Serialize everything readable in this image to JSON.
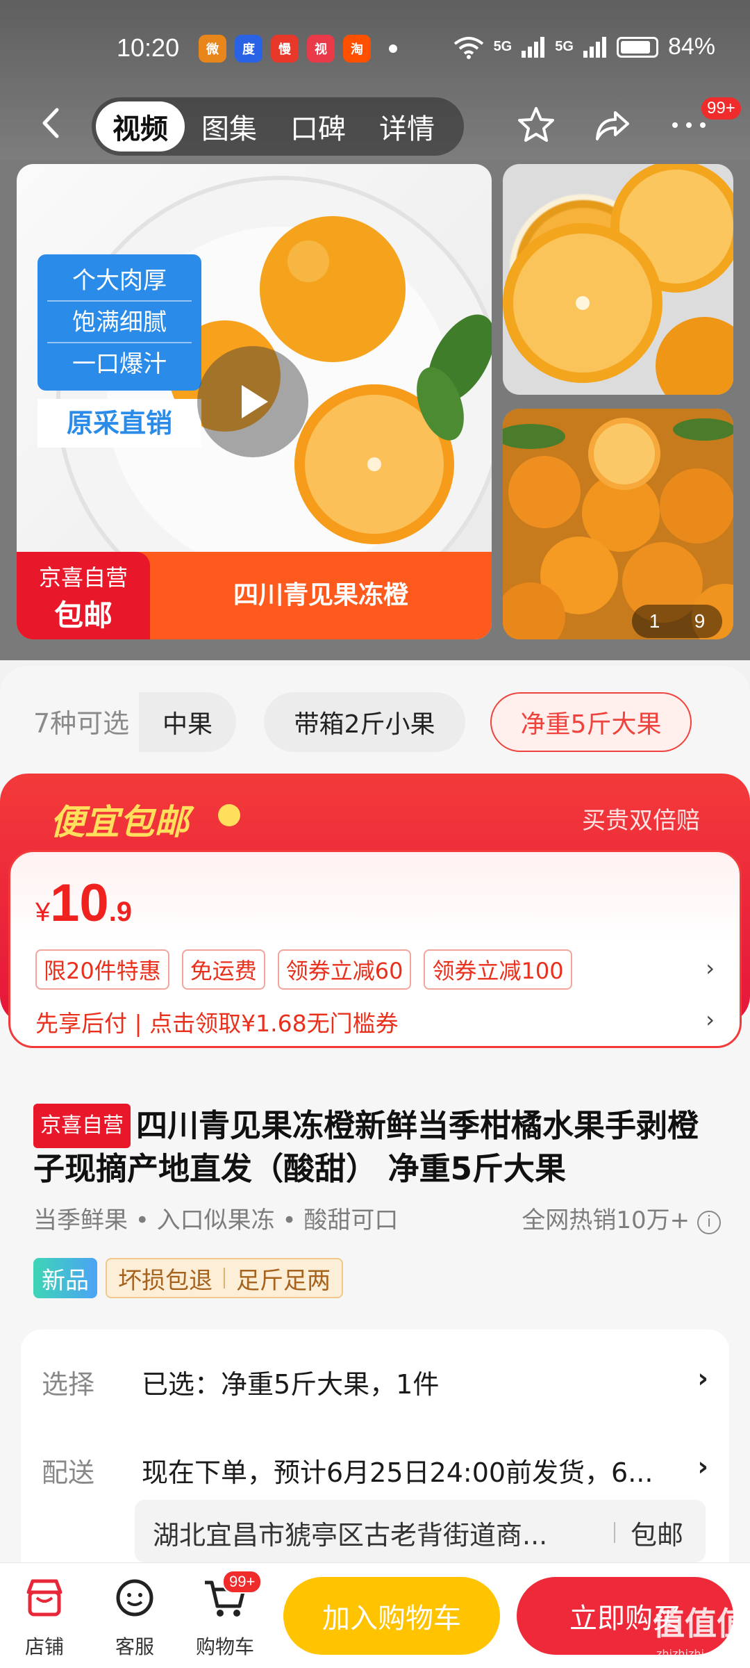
{
  "status_bar": {
    "time": "10:20",
    "notifications": [
      "weibo-icon",
      "baidu-icon",
      "man-icon",
      "weishi-icon",
      "taobao-icon"
    ],
    "signal1": "5G",
    "signal2": "5G",
    "battery": "84%"
  },
  "nav": {
    "tabs": [
      {
        "label": "视频",
        "active": true
      },
      {
        "label": "图集",
        "active": false
      },
      {
        "label": "口碑",
        "active": false
      },
      {
        "label": "详情",
        "active": false
      }
    ],
    "more_badge": "99+"
  },
  "gallery": {
    "labels": [
      "个大肉厚",
      "饱满细腻",
      "一口爆汁"
    ],
    "label_sub": "原采直销",
    "jx_line1": "京喜自营",
    "jx_line2": "包邮",
    "strip_title": "四川青见果冻橙",
    "counter_current": "1",
    "counter_total": "9"
  },
  "variants": {
    "count_label": "7种可选",
    "chips": [
      "中果",
      "带箱2斤小果",
      "净重5斤大果"
    ],
    "selected": "净重5斤大果"
  },
  "promo": {
    "title": "便宜包邮",
    "right_text": "买贵双倍赔",
    "price_symbol": "¥",
    "price_int": "10",
    "price_dec": ".9",
    "tags": [
      "限20件特惠",
      "免运费",
      "领券立减60",
      "领券立减100"
    ],
    "line2": "先享后付 | 点击领取¥1.68无门槛券",
    "colors": {
      "accent": "#e5163a",
      "price": "#f0221f",
      "title": "#ffdf5c"
    }
  },
  "product": {
    "jx_tag": "京喜自营",
    "title": "四川青见果冻橙新鲜当季柑橘水果手剥橙子现摘产地直发（酸甜） 净重5斤大果",
    "features": "当季鲜果 • 入口似果冻 • 酸甜可口",
    "sales": "全网热销10万+",
    "new_badge": "新品",
    "guarantees": [
      "坏损包退",
      "足斤足两"
    ]
  },
  "spec": {
    "select_key": "选择",
    "select_value": "已选：净重5斤大果，1件",
    "delivery_key": "配送",
    "delivery_value": "现在下单，预计6月25日24:00前发货，6...",
    "address": "湖北宜昌市猇亭区古老背街道商...",
    "shipping": "包邮"
  },
  "bottom_bar": {
    "store": "店铺",
    "service": "客服",
    "cart": "购物车",
    "cart_badge": "99+",
    "add_cart": "加入购物车",
    "buy_now": "立即购买"
  },
  "watermark": {
    "logo": "值值值",
    "site": "zhizhizhi.com"
  }
}
